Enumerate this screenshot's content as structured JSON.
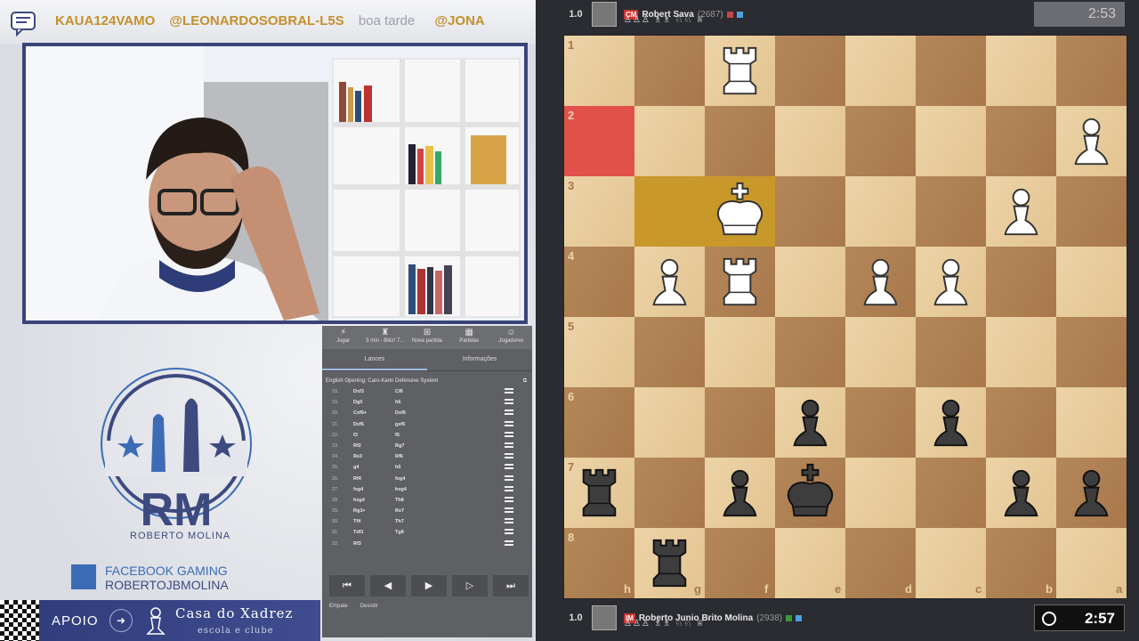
{
  "ticker": {
    "messages": [
      {
        "user": "KAUA124VAMO",
        "text": ""
      },
      {
        "user": "@LEONARDOSOBRAL-L5S",
        "text": "boa tarde"
      },
      {
        "user": "@JONA",
        "text": ""
      }
    ]
  },
  "branding": {
    "initials": "RM",
    "name": "ROBERTO MOLINA",
    "social_line1": "FACEBOOK GAMING",
    "social_line2": "ROBERTOJBMOLINA",
    "support_label": "APOIO",
    "sponsor_name": "Casa do Xadrez",
    "sponsor_sub": "escola e clube"
  },
  "panel": {
    "top_tabs": [
      "Jogar",
      "5 min - Blitz! 7...",
      "Nova partida",
      "Partidas",
      "Jogadores"
    ],
    "sub_tabs": [
      "Lances",
      "Informações"
    ],
    "opening": "English Opening: Caro-Kann Defensive System",
    "moves": [
      {
        "n": "18.",
        "w": "Dxf3",
        "b": "Cf6"
      },
      {
        "n": "19.",
        "w": "Dg5",
        "b": "h6"
      },
      {
        "n": "20.",
        "w": "Cxf6+",
        "b": "Dxf6"
      },
      {
        "n": "21.",
        "w": "Dxf6",
        "b": "gxf6"
      },
      {
        "n": "22.",
        "w": "f3",
        "b": "f5"
      },
      {
        "n": "23.",
        "w": "Rf2",
        "b": "Rg7"
      },
      {
        "n": "24.",
        "w": "Re3",
        "b": "Rf6"
      },
      {
        "n": "25.",
        "w": "g4",
        "b": "h5"
      },
      {
        "n": "26.",
        "w": "Rf4",
        "b": "fxg4"
      },
      {
        "n": "27.",
        "w": "fxg4",
        "b": "hxg4"
      },
      {
        "n": "28.",
        "w": "hxg4",
        "b": "Th8"
      },
      {
        "n": "29.",
        "w": "Rg3+",
        "b": "Re7"
      },
      {
        "n": "30.",
        "w": "Tf4",
        "b": "Th7"
      },
      {
        "n": "31.",
        "w": "Tdf1",
        "b": "Tg8"
      },
      {
        "n": "32.",
        "w": "Rf3",
        "b": ""
      }
    ],
    "nav_buttons": [
      "⏮",
      "◀",
      "▶",
      "▷",
      "⏭"
    ],
    "footer": [
      "Empate",
      "Desistir"
    ]
  },
  "top_player": {
    "rating_box": "1.0",
    "title": "CM",
    "name": "Robert Sava",
    "elo": "(2687)",
    "material": "♙♙♙ ♗♗ ♘♘ ♕",
    "clock": "2:53"
  },
  "bottom_player": {
    "rating_box": "1.0",
    "title": "IM",
    "name": "Roberto Junio Brito Molina",
    "elo": "(2938)",
    "material": "♙♙♙ ♗♗ ♘♘ ♕",
    "clock": "2:57"
  },
  "board": {
    "files_bottom": [
      "h",
      "g",
      "f",
      "e",
      "d",
      "c",
      "b",
      "a"
    ],
    "ranks_left": [
      "1",
      "2",
      "3",
      "4",
      "5",
      "6",
      "7",
      "8"
    ],
    "highlight_red": "h2",
    "highlight_last": [
      "g3",
      "f3"
    ],
    "pieces": [
      {
        "c": 2,
        "r": 0,
        "p": "R",
        "w": true
      },
      {
        "c": 7,
        "r": 1,
        "p": "P",
        "w": true
      },
      {
        "c": 2,
        "r": 2,
        "p": "K",
        "w": true
      },
      {
        "c": 6,
        "r": 2,
        "p": "P",
        "w": true
      },
      {
        "c": 1,
        "r": 3,
        "p": "P",
        "w": true
      },
      {
        "c": 2,
        "r": 3,
        "p": "R",
        "w": true
      },
      {
        "c": 4,
        "r": 3,
        "p": "P",
        "w": true
      },
      {
        "c": 5,
        "r": 3,
        "p": "P",
        "w": true
      },
      {
        "c": 3,
        "r": 5,
        "p": "P",
        "w": false
      },
      {
        "c": 5,
        "r": 5,
        "p": "P",
        "w": false
      },
      {
        "c": 0,
        "r": 6,
        "p": "R",
        "w": false
      },
      {
        "c": 2,
        "r": 6,
        "p": "P",
        "w": false
      },
      {
        "c": 3,
        "r": 6,
        "p": "K",
        "w": false
      },
      {
        "c": 6,
        "r": 6,
        "p": "P",
        "w": false
      },
      {
        "c": 7,
        "r": 6,
        "p": "P",
        "w": false
      },
      {
        "c": 1,
        "r": 7,
        "p": "R",
        "w": false
      }
    ],
    "colors": {
      "light": "#e9cda0",
      "dark": "#b08256",
      "last": "#c9982a",
      "red": "#e2504a"
    }
  }
}
